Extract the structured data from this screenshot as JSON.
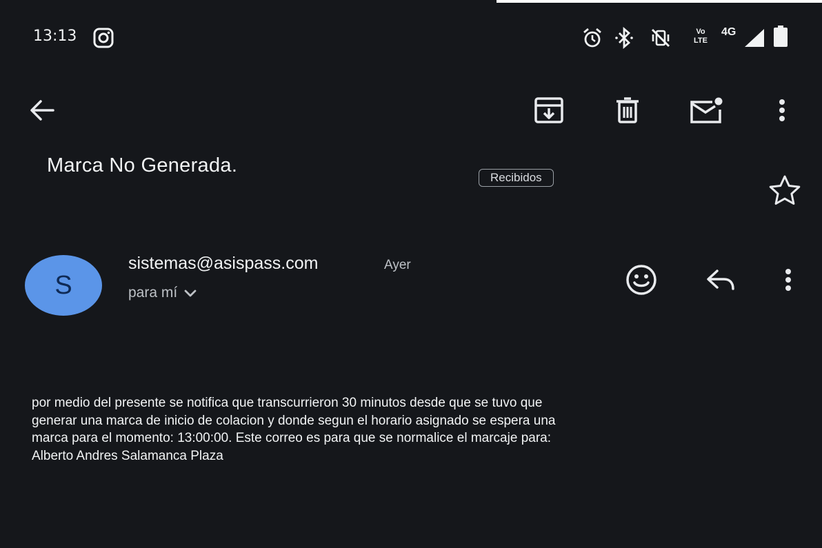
{
  "status_bar": {
    "time": "13:13",
    "network_type": "4G",
    "volte_label": "Vo LTE",
    "icons": [
      "instagram-icon",
      "alarm-icon",
      "bluetooth-icon",
      "vibrate-icon",
      "signal-icon",
      "battery-icon"
    ]
  },
  "toolbar": {
    "icons": [
      "back-arrow-icon",
      "archive-icon",
      "delete-icon",
      "mark-unread-icon",
      "more-vert-icon"
    ]
  },
  "email": {
    "subject": "Marca No Generada.",
    "label": "Recibidos",
    "sender": "sistemas@asispass.com",
    "avatar_initial": "S",
    "avatar_color": "#5b95e8",
    "date": "Ayer",
    "recipient": "para mí",
    "body_lines": [
      "por medio del presente se notifica que transcurrieron 30 minutos desde que se tuvo que",
      "generar una marca de inicio de colacion y donde segun el horario asignado se espera una",
      "marca para el momento: 13:00:00. Este correo es para que se normalice el marcaje para:",
      "Alberto Andres Salamanca Plaza"
    ]
  },
  "colors": {
    "background": "#15171b",
    "text": "#f1f3f4"
  }
}
